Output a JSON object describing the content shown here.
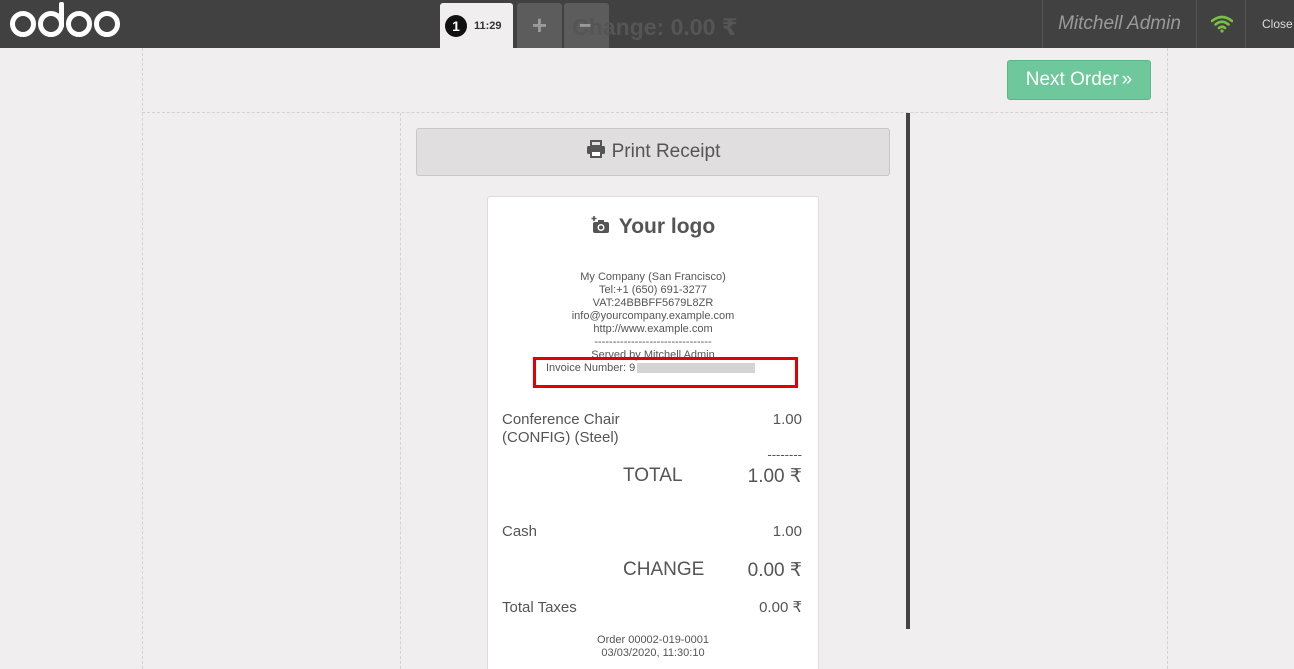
{
  "topbar": {
    "brand": "odoo",
    "order_tab": {
      "number": "1",
      "time": "11:29"
    },
    "add_order_label": "+",
    "remove_order_label": "−",
    "user_name": "Mitchell Admin",
    "close_label": "Close",
    "wifi_color": "#7ac143"
  },
  "header": {
    "change_text": "Change: 0.00 ₹",
    "next_order_label": "Next Order",
    "next_order_color": "#6ec89b"
  },
  "print_receipt_label": "Print Receipt",
  "receipt": {
    "logo_text": "Your logo",
    "company": {
      "name": "My Company (San Francisco)",
      "tel": "Tel:+1 (650) 691-3277",
      "vat": "VAT:24BBBFF5679L8ZR",
      "email": "info@yourcompany.example.com",
      "website": "http://www.example.com",
      "separator": "--------------------------------",
      "served_by": "Served by Mitchell Admin"
    },
    "invoice_label": "Invoice Number: 9",
    "lines": [
      {
        "product": "Conference Chair (CONFIG) (Steel)",
        "amount": "1.00"
      }
    ],
    "dashes": "--------",
    "total_label": "TOTAL",
    "total_value": "1.00 ₹",
    "payment_method": "Cash",
    "payment_amount": "1.00",
    "change_label": "CHANGE",
    "change_value": "0.00 ₹",
    "taxes_label": "Total Taxes",
    "taxes_value": "0.00 ₹",
    "order_ref": "Order 00002-019-0001",
    "order_datetime": "03/03/2020, 11:30:10"
  }
}
